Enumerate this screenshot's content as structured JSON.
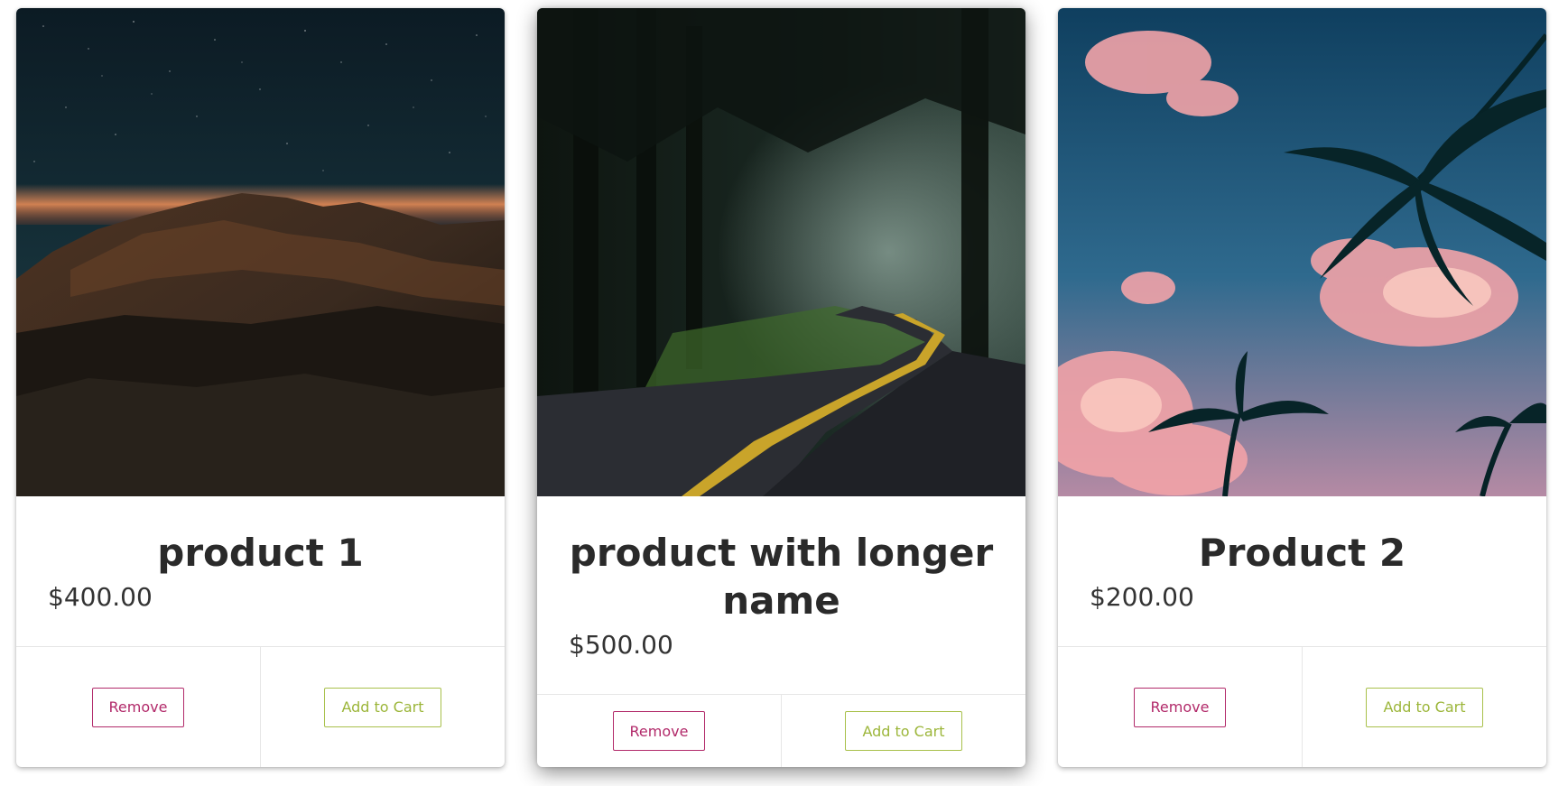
{
  "products": [
    {
      "name": "product 1",
      "price": "$400.00",
      "image": "night-mountain-stars",
      "remove_label": "Remove",
      "add_label": "Add to Cart"
    },
    {
      "name": "product with longer name",
      "price": "$500.00",
      "image": "forest-winding-road",
      "remove_label": "Remove",
      "add_label": "Add to Cart"
    },
    {
      "name": "Product 2",
      "price": "$200.00",
      "image": "palm-trees-pink-clouds",
      "remove_label": "Remove",
      "add_label": "Add to Cart"
    }
  ],
  "colors": {
    "remove": "#b22a6a",
    "add_to_cart": "#9cb63a",
    "title_text": "#2a2a2a"
  }
}
